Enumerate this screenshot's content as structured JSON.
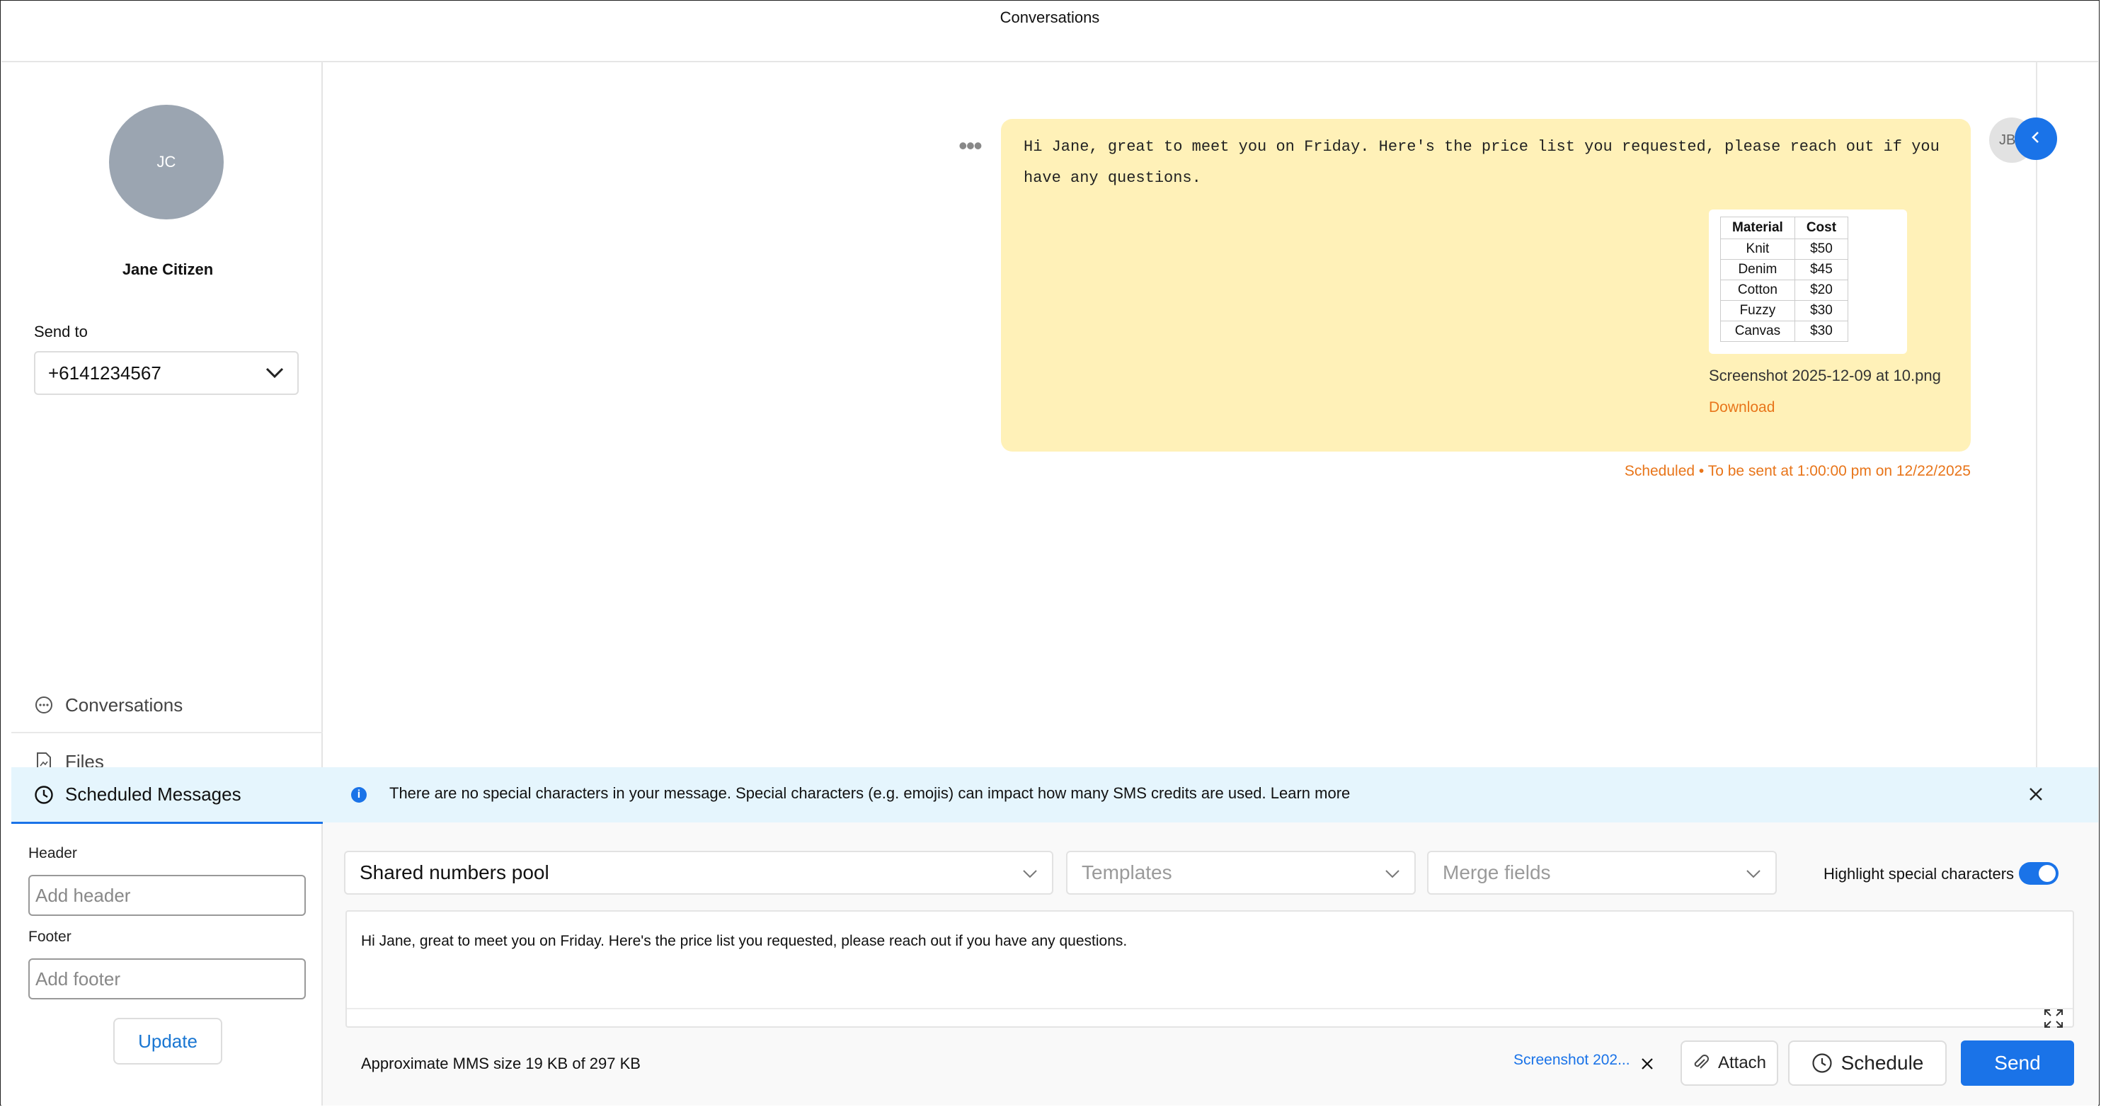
{
  "window": {
    "title": "Conversations"
  },
  "contact": {
    "initials": "JC",
    "name": "Jane Citizen"
  },
  "send_to": {
    "label": "Send to",
    "value": "+6141234567"
  },
  "nav": {
    "conversations": "Conversations",
    "files": "Files",
    "scheduled": "Scheduled Messages"
  },
  "header_field": {
    "label": "Header",
    "placeholder": "Add header"
  },
  "footer_field": {
    "label": "Footer",
    "placeholder": "Add footer"
  },
  "update_label": "Update",
  "message": {
    "text": "Hi Jane, great to meet you on Friday. Here's the price list you requested, please reach out if you have any questions.",
    "attachment": {
      "table": {
        "headers": [
          "Material",
          "Cost"
        ],
        "rows": [
          [
            "Knit",
            "$50"
          ],
          [
            "Denim",
            "$45"
          ],
          [
            "Cotton",
            "$20"
          ],
          [
            "Fuzzy",
            "$30"
          ],
          [
            "Canvas",
            "$30"
          ]
        ]
      },
      "file_name": "Screenshot 2025-12-09 at 10.png",
      "download_label": "Download"
    },
    "status": "Scheduled • To be sent at 1:00:00 pm on 12/22/2025",
    "sender_initials": "JB"
  },
  "info_banner": {
    "text": "There are no special characters in your message. Special characters (e.g. emojis) can impact how many SMS credits are used. Learn more"
  },
  "composer": {
    "number_pool": "Shared numbers pool",
    "templates_placeholder": "Templates",
    "merge_fields_placeholder": "Merge fields",
    "highlight_label": "Highlight special characters",
    "highlight_enabled": true,
    "message_text": "Hi Jane, great to meet you on Friday. Here's the price list you requested, please reach out if you have any questions.",
    "mms_size": "Approximate MMS size 19 KB of 297 KB",
    "attachment_name": "Screenshot 202...",
    "attach_label": "Attach",
    "schedule_label": "Schedule",
    "send_label": "Send"
  },
  "colors": {
    "accent": "#1a73e8",
    "bubble": "#fff1b8",
    "scheduled": "#e8751a",
    "info_bg": "#e5f5fd",
    "avatar": "#9ba5b1"
  }
}
